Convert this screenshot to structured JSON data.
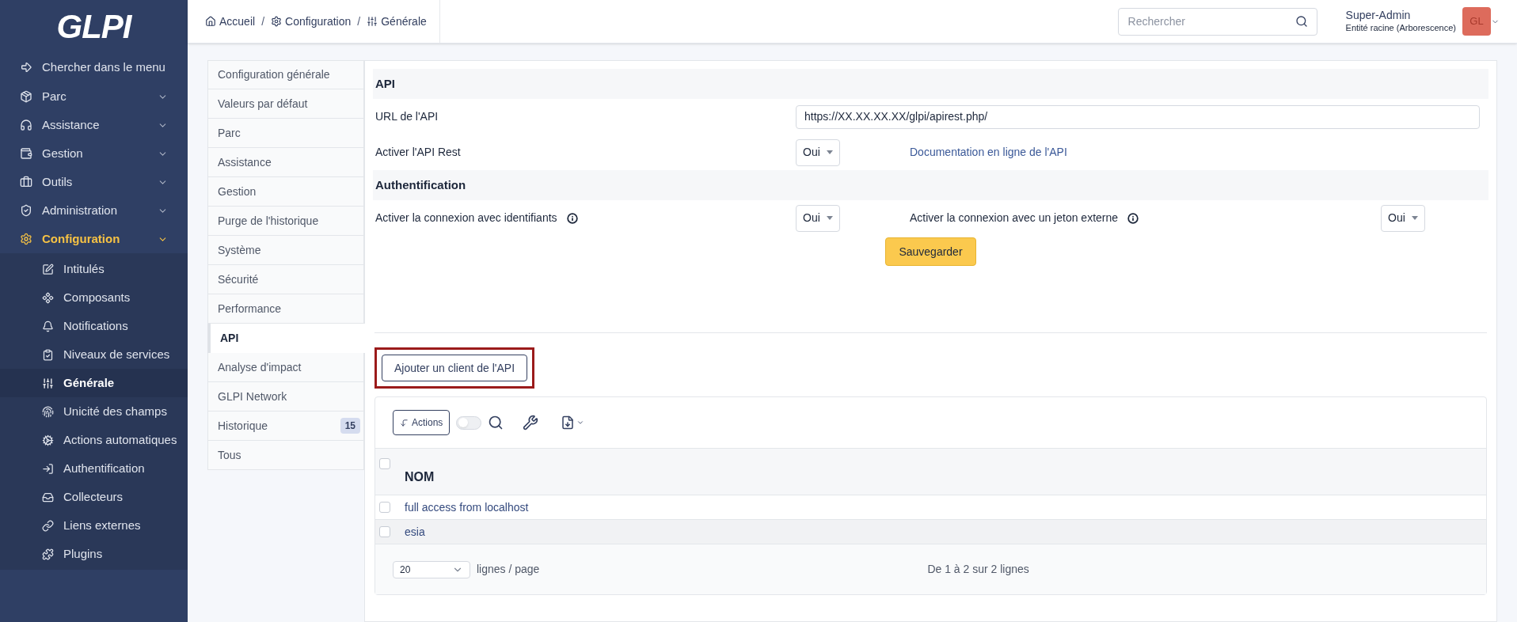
{
  "sidebar": {
    "logo": "GLPI",
    "search_item": "Chercher dans le menu",
    "items": [
      {
        "label": "Parc",
        "expanded": false
      },
      {
        "label": "Assistance",
        "expanded": false
      },
      {
        "label": "Gestion",
        "expanded": false
      },
      {
        "label": "Outils",
        "expanded": false
      },
      {
        "label": "Administration",
        "expanded": false
      },
      {
        "label": "Configuration",
        "expanded": true,
        "children": [
          {
            "label": "Intitulés",
            "selected": false
          },
          {
            "label": "Composants",
            "selected": false
          },
          {
            "label": "Notifications",
            "selected": false
          },
          {
            "label": "Niveaux de services",
            "selected": false
          },
          {
            "label": "Générale",
            "selected": true
          },
          {
            "label": "Unicité des champs",
            "selected": false
          },
          {
            "label": "Actions automatiques",
            "selected": false
          },
          {
            "label": "Authentification",
            "selected": false
          },
          {
            "label": "Collecteurs",
            "selected": false
          },
          {
            "label": "Liens externes",
            "selected": false
          },
          {
            "label": "Plugins",
            "selected": false
          }
        ]
      }
    ]
  },
  "breadcrumb": {
    "separator": "/",
    "items": [
      "Accueil",
      "Configuration",
      "Générale"
    ]
  },
  "search": {
    "placeholder": "Rechercher"
  },
  "user": {
    "name": "Super-Admin",
    "entity": "Entité racine (Arborescence)",
    "initials": "GL"
  },
  "tabs": [
    {
      "label": "Configuration générale",
      "selected": false
    },
    {
      "label": "Valeurs par défaut",
      "selected": false
    },
    {
      "label": "Parc",
      "selected": false
    },
    {
      "label": "Assistance",
      "selected": false
    },
    {
      "label": "Gestion",
      "selected": false
    },
    {
      "label": "Purge de l'historique",
      "selected": false
    },
    {
      "label": "Système",
      "selected": false
    },
    {
      "label": "Sécurité",
      "selected": false
    },
    {
      "label": "Performance",
      "selected": false
    },
    {
      "label": "API",
      "selected": true
    },
    {
      "label": "Analyse d'impact",
      "selected": false
    },
    {
      "label": "GLPI Network",
      "selected": false
    },
    {
      "label": "Historique",
      "selected": false,
      "count": "15"
    },
    {
      "label": "Tous",
      "selected": false
    }
  ],
  "api_form": {
    "sections": [
      {
        "title": "API",
        "rows": [
          {
            "kind": "text",
            "label": "URL de l'API",
            "value": "https://XX.XX.XX.XX/glpi/apirest.php/"
          },
          {
            "kind": "select",
            "label": "Activer l'API Rest",
            "value": "Oui",
            "link": "Documentation en ligne de l'API"
          }
        ]
      },
      {
        "title": "Authentification",
        "rows": [
          {
            "kind": "select",
            "label": "Activer la connexion avec identifiants",
            "info": true,
            "value": "Oui",
            "second": {
              "label": "Activer la connexion avec un jeton externe",
              "info": true,
              "value": "Oui"
            }
          }
        ]
      }
    ],
    "save_button": "Sauvegarder"
  },
  "add_client_button": {
    "label": "Ajouter un client de l'API",
    "highlighted": true
  },
  "clients_table": {
    "actions_button": "Actions",
    "toggle_on": false,
    "header_checked": false,
    "columns": [
      "NOM"
    ],
    "rows": [
      {
        "name": "full access from localhost",
        "checked": false
      },
      {
        "name": "esia",
        "checked": false
      }
    ],
    "page_size": "20",
    "page_size_label": "lignes / page",
    "summary": "De 1 à 2 sur 2 lignes"
  }
}
